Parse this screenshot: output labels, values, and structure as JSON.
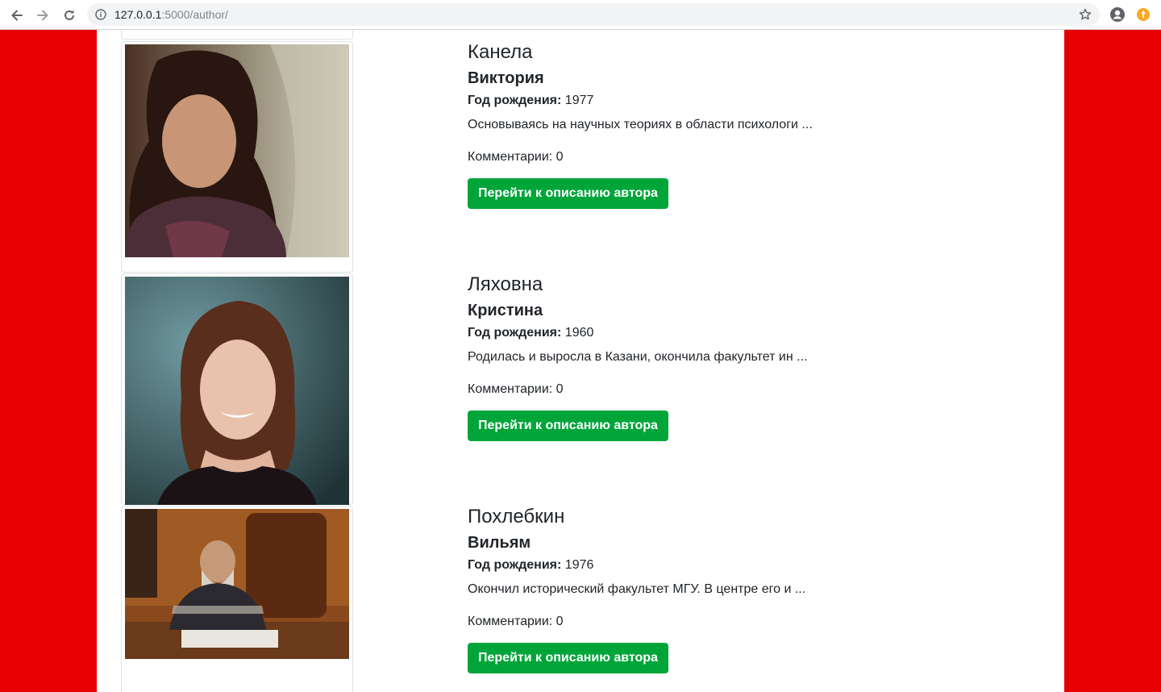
{
  "browser": {
    "url_host": "127.0.0.1",
    "url_path": ":5000/author/"
  },
  "theme": {
    "side_color": "#e60000",
    "button_color": "#00a53a"
  },
  "authors": [
    {
      "surname": "Канела",
      "first_name": "Виктория",
      "birth_year_label": "Год рождения:",
      "birth_year": "1977",
      "bio_excerpt": "Основываясь на научных теориях в области психологи ...",
      "comments_label": "Комментарии:",
      "comments_count": "0",
      "button_label": "Перейти к описанию автора"
    },
    {
      "surname": "Ляховна",
      "first_name": "Кристина",
      "birth_year_label": "Год рождения:",
      "birth_year": "1960",
      "bio_excerpt": "Родилась и выросла в Казани, окончила факультет ин ...",
      "comments_label": "Комментарии:",
      "comments_count": "0",
      "button_label": "Перейти к описанию автора"
    },
    {
      "surname": "Похлебкин",
      "first_name": "Вильям",
      "birth_year_label": "Год рождения:",
      "birth_year": "1976",
      "bio_excerpt": "Окончил исторический факультет МГУ. В центре его и ...",
      "comments_label": "Комментарии:",
      "comments_count": "0",
      "button_label": "Перейти к описанию автора"
    }
  ]
}
